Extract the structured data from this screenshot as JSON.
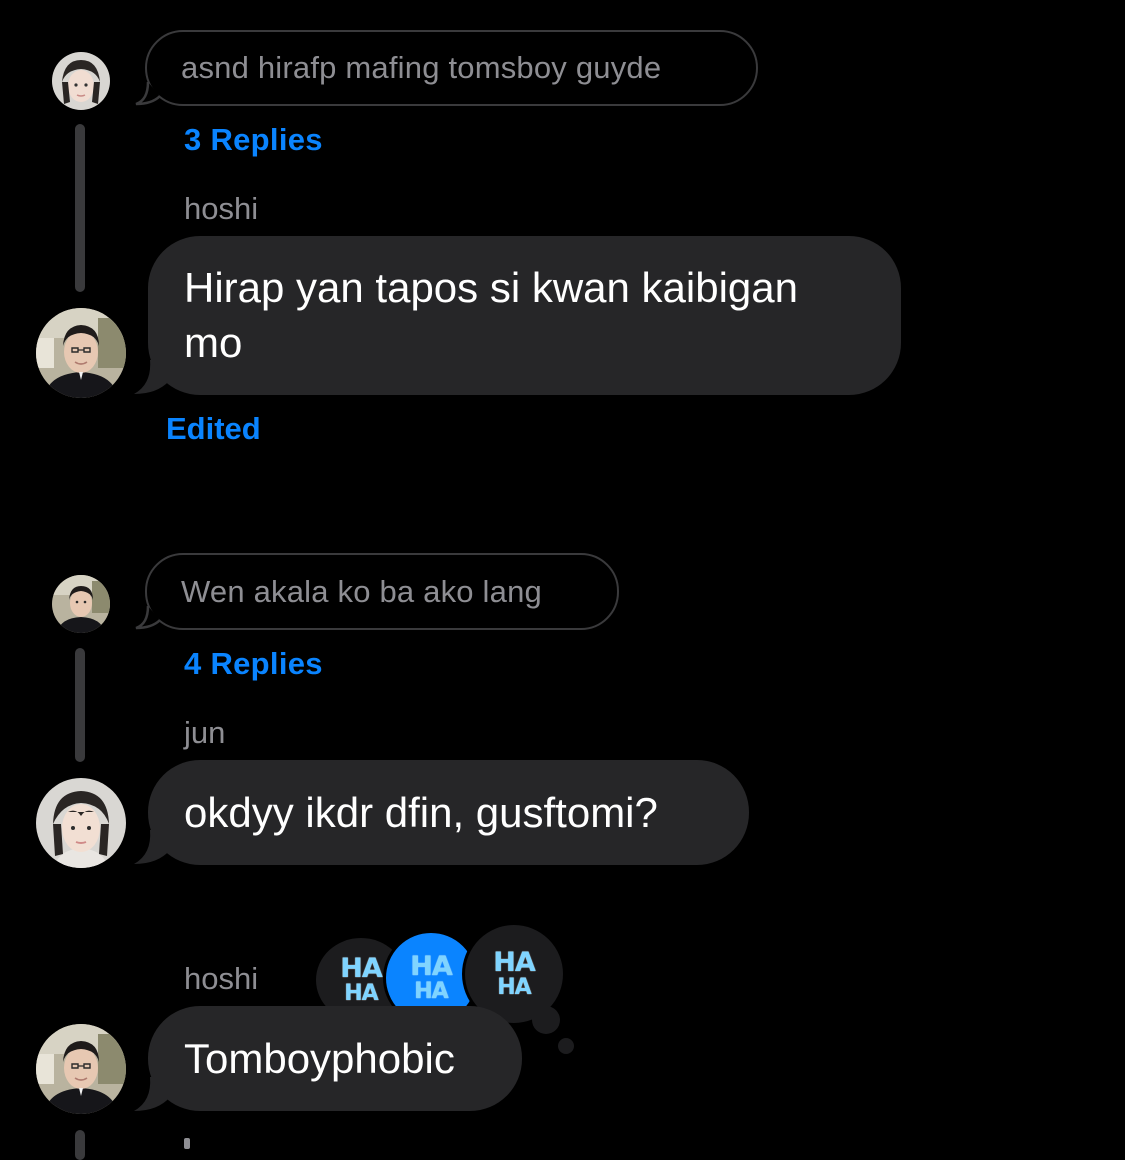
{
  "threads": [
    {
      "reply_preview": "asnd hirafp mafing tomsboy guyde",
      "replies_link": "3 Replies",
      "sender": "hoshi",
      "message": "Hirap yan tapos si kwan kaibigan mo",
      "message_line1": "Hirap yan tapos si kwan kaibigan",
      "message_line2": "mo",
      "status": "Edited"
    },
    {
      "reply_preview": "Wen akala ko ba ako lang",
      "replies_link": "4 Replies",
      "sender": "jun",
      "message": "okdyy ikdr dfin, gusftomi?"
    },
    {
      "sender": "hoshi",
      "message": "Tomboyphobic",
      "reactions": [
        {
          "line1": "HA",
          "line2": "HA",
          "label": "haha-sticker"
        },
        {
          "line1": "HA",
          "line2": "HA",
          "label": "haha-sticker"
        },
        {
          "line1": "HA",
          "line2": "HA",
          "label": "haha-sticker"
        }
      ]
    }
  ],
  "colors": {
    "background": "#000000",
    "bubble": "#262628",
    "link": "#0a84ff",
    "muted_text": "#8e8e93",
    "thread_line": "#3a3a3c"
  },
  "icons": [
    "avatar-jun",
    "avatar-hoshi",
    "haha-reaction-icon"
  ]
}
